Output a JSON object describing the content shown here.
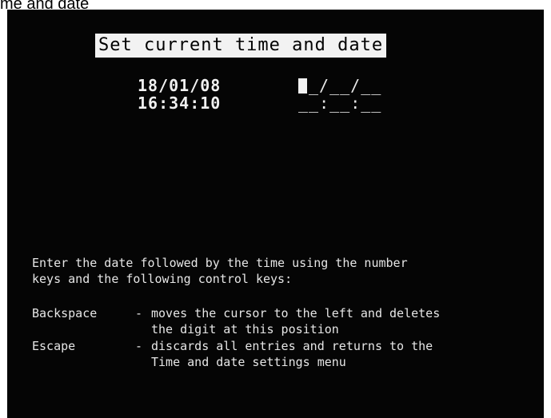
{
  "caption": "me and date",
  "screen": {
    "title": "Set current time and date",
    "current_date": "18/01/08",
    "current_time": "16:34:10",
    "entry_date_rest": "_/__/__",
    "entry_time": "__:__:__",
    "instructions": [
      "Enter the date followed by the time using the number",
      "keys and the following control keys:"
    ],
    "keys": [
      {
        "key": "Backspace",
        "dash": "-",
        "lines": [
          "moves the cursor to the left and deletes",
          "the digit at this position"
        ]
      },
      {
        "key": "Escape",
        "dash": "-",
        "lines": [
          "discards all entries and returns to the",
          "Time and date settings menu"
        ]
      }
    ]
  },
  "colors": {
    "screen_background": "#050505",
    "text": "#e6e6e6",
    "title_background": "#f2f2f2"
  }
}
